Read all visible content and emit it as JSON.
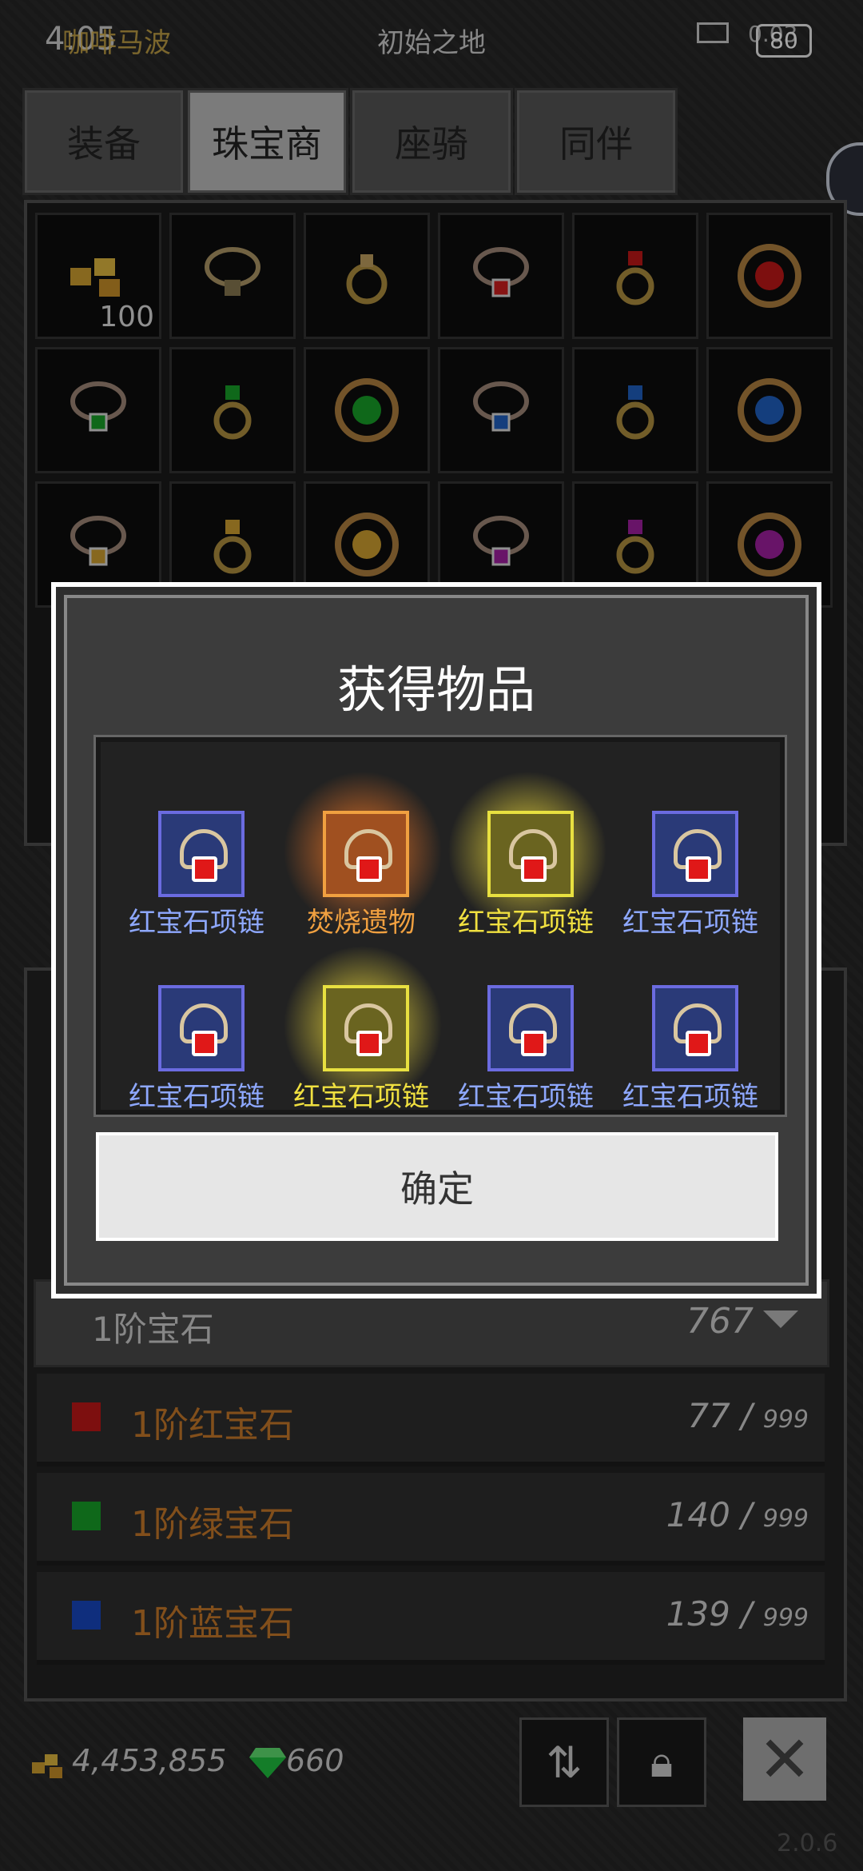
{
  "status_bar": {
    "time": "4:05",
    "user": "咖啡马波",
    "location": "初始之地",
    "battery": "80",
    "signal_text": "0.03"
  },
  "tabs": [
    {
      "label": "装备",
      "active": false
    },
    {
      "label": "珠宝商",
      "active": true
    },
    {
      "label": "座骑",
      "active": false
    },
    {
      "label": "同伴",
      "active": false
    }
  ],
  "inventory": {
    "first_qty": "100"
  },
  "gem_section": {
    "header_label": "1阶宝石",
    "header_count": "767",
    "rows": [
      {
        "name": "1阶红宝石",
        "count": "77",
        "max": "999",
        "color": "#c01818"
      },
      {
        "name": "1阶绿宝石",
        "count": "140",
        "max": "999",
        "color": "#18a028"
      },
      {
        "name": "1阶蓝宝石",
        "count": "139",
        "max": "999",
        "color": "#1848c0"
      }
    ]
  },
  "footer": {
    "gold": "4,453,855",
    "gems": "660",
    "version": "2.0.6"
  },
  "dialog": {
    "title": "获得物品",
    "items": [
      {
        "name": "红宝石项链",
        "rarity": "blue"
      },
      {
        "name": "焚烧遗物",
        "rarity": "orange"
      },
      {
        "name": "红宝石项链",
        "rarity": "gold"
      },
      {
        "name": "红宝石项链",
        "rarity": "blue"
      },
      {
        "name": "红宝石项链",
        "rarity": "blue"
      },
      {
        "name": "红宝石项链",
        "rarity": "gold"
      },
      {
        "name": "红宝石项链",
        "rarity": "blue"
      },
      {
        "name": "红宝石项链",
        "rarity": "blue"
      }
    ],
    "confirm_label": "确定"
  },
  "colors": {
    "gold_rarity": "#f0e040",
    "blue_rarity": "#8ea8ff",
    "orange_rarity": "#f0a040"
  },
  "icons": {
    "gold": "gold-nuggets-icon",
    "gem": "green-gem-icon",
    "swap": "swap-icon",
    "lock": "lock-icon",
    "close": "close-icon"
  }
}
